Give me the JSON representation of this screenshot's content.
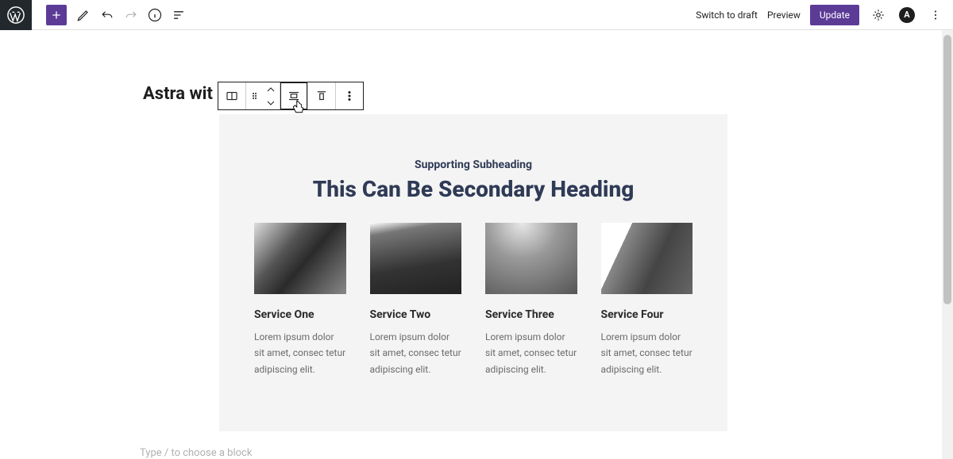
{
  "topbar": {
    "switch_draft": "Switch to draft",
    "preview": "Preview",
    "update": "Update"
  },
  "page": {
    "title": "Astra wit",
    "type_placeholder": "Type / to choose a block"
  },
  "section": {
    "subheading": "Supporting Subheading",
    "heading": "This Can Be Secondary Heading",
    "services": [
      {
        "title": "Service One",
        "desc": "Lorem ipsum dolor sit amet, consec tetur adipiscing elit."
      },
      {
        "title": "Service Two",
        "desc": "Lorem ipsum dolor sit amet, consec tetur adipiscing elit."
      },
      {
        "title": "Service Three",
        "desc": "Lorem ipsum dolor sit amet, consec tetur adipiscing elit."
      },
      {
        "title": "Service Four",
        "desc": "Lorem ipsum dolor sit amet, consec tetur adipiscing elit."
      }
    ]
  },
  "astra_badge": "A"
}
